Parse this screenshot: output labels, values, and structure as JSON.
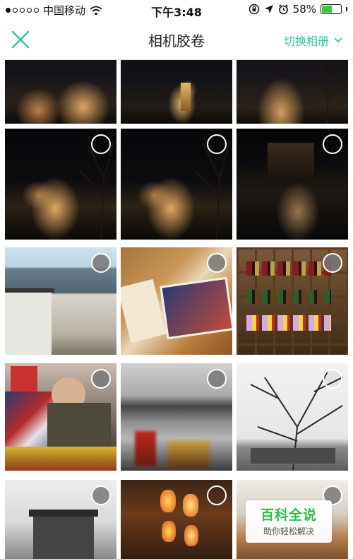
{
  "status_bar": {
    "carrier": "中国移动",
    "time": "下午3:48",
    "battery_percent": "58%",
    "battery_level": 0.58
  },
  "nav": {
    "title": "相机胶卷",
    "switch_album_label": "切换相册",
    "accent_color": "#32c2a8"
  },
  "watermark": {
    "title": "百科全说",
    "subtitle": "助你轻松解决"
  },
  "photos": [
    {
      "desc": "night-city-1"
    },
    {
      "desc": "night-city-2"
    },
    {
      "desc": "night-city-3"
    },
    {
      "desc": "night-tree-1"
    },
    {
      "desc": "night-tree-2"
    },
    {
      "desc": "night-building"
    },
    {
      "desc": "village-walls"
    },
    {
      "desc": "postcards"
    },
    {
      "desc": "wine-shelf"
    },
    {
      "desc": "elderly-craftsman"
    },
    {
      "desc": "water-reflection"
    },
    {
      "desc": "bare-tree-village"
    },
    {
      "desc": "old-house"
    },
    {
      "desc": "lanterns"
    },
    {
      "desc": "shop"
    }
  ]
}
